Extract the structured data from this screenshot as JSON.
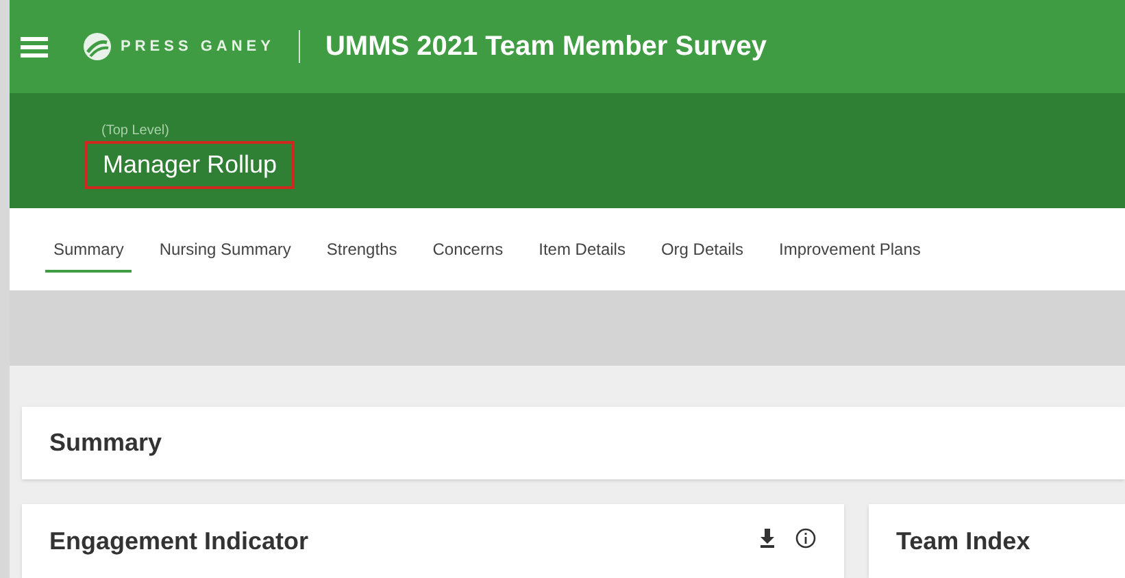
{
  "header": {
    "brand": "PRESS GANEY",
    "title": "UMMS 2021 Team Member Survey"
  },
  "level": {
    "caption": "(Top Level)",
    "name": "Manager Rollup",
    "highlighted": true
  },
  "tabs": [
    {
      "label": "Summary",
      "selected": true
    },
    {
      "label": "Nursing Summary",
      "selected": false
    },
    {
      "label": "Strengths",
      "selected": false
    },
    {
      "label": "Concerns",
      "selected": false
    },
    {
      "label": "Item Details",
      "selected": false
    },
    {
      "label": "Org Details",
      "selected": false
    },
    {
      "label": "Improvement Plans",
      "selected": false
    }
  ],
  "summary": {
    "title": "Summary"
  },
  "cards": [
    {
      "title": "Engagement Indicator",
      "actions": true
    },
    {
      "title": "Team Index",
      "actions": false
    }
  ]
}
